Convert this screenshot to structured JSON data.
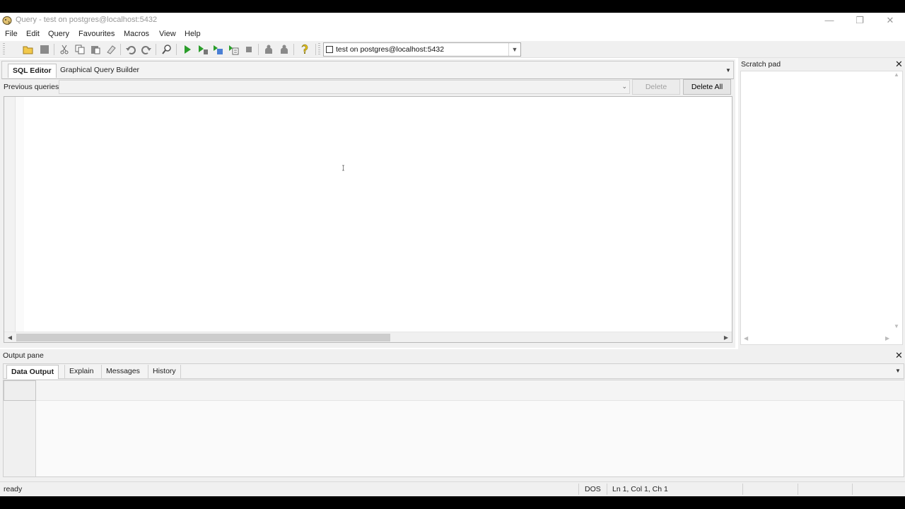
{
  "window": {
    "title": "Query - test on postgres@localhost:5432",
    "minimize_glyph": "—",
    "maximize_glyph": "❐",
    "close_glyph": "✕"
  },
  "menu": {
    "items": [
      "File",
      "Edit",
      "Query",
      "Favourites",
      "Macros",
      "View",
      "Help"
    ]
  },
  "toolbar": {
    "icons": [
      "open-file-icon",
      "save-icon",
      "cut-icon",
      "copy-icon",
      "paste-icon",
      "clear-icon",
      "undo-icon",
      "redo-icon",
      "find-icon",
      "execute-icon",
      "execute-pgscript-icon",
      "execute-to-file-icon",
      "explain-icon",
      "cancel-icon",
      "explain-analyze-icon",
      "explain-options-icon",
      "help-icon"
    ],
    "connection_label": "test on postgres@localhost:5432"
  },
  "editor": {
    "tabs": [
      {
        "label": "SQL Editor",
        "active": true
      },
      {
        "label": "Graphical Query Builder",
        "active": false
      }
    ],
    "previous_queries_label": "Previous queries",
    "previous_queries_value": "",
    "delete_label": "Delete",
    "delete_all_label": "Delete All",
    "content": ""
  },
  "scratch_pad": {
    "title": "Scratch pad",
    "content": ""
  },
  "output_pane": {
    "title": "Output pane",
    "tabs": [
      {
        "label": "Data Output",
        "active": true
      },
      {
        "label": "Explain",
        "active": false
      },
      {
        "label": "Messages",
        "active": false
      },
      {
        "label": "History",
        "active": false
      }
    ]
  },
  "status_bar": {
    "status": "ready",
    "line_ending": "DOS",
    "position": "Ln 1, Col 1, Ch 1"
  },
  "colors": {
    "accent_green": "#2a9d2a",
    "icon_gray": "#8a8a8a",
    "help_yellow": "#e8c21a"
  }
}
